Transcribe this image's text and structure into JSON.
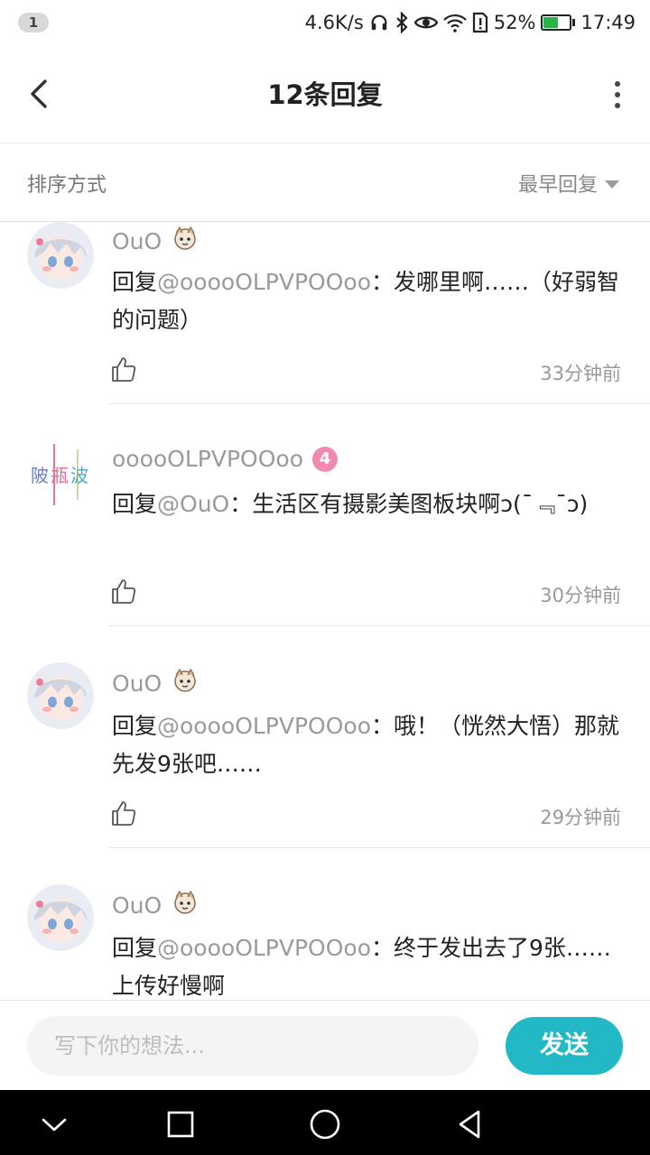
{
  "status_bar": {
    "notification_count": "1",
    "network_speed": "4.6K/s",
    "battery_percent": "52%",
    "battery_level": 0.52,
    "time": "17:49"
  },
  "header": {
    "title": "12条回复",
    "back_icon": "back-arrow-icon",
    "more_icon": "more-vertical-icon"
  },
  "sort": {
    "label": "排序方式",
    "selected": "最早回复"
  },
  "replies": [
    {
      "username": "OuO",
      "prefix": "回复",
      "mention": "@ooooOLPVPOOoo",
      "text": "：发哪里啊……（好弱智的问题）",
      "time": "33分钟前"
    },
    {
      "username": "ooooOLPVPOOoo",
      "level": "4",
      "prefix": "回复",
      "mention": "@OuO",
      "text": "：生活区有摄影美图板块啊ↄ(¯﹃¯ↄ)",
      "time": "30分钟前"
    },
    {
      "username": "OuO",
      "prefix": "回复",
      "mention": "@ooooOLPVPOOoo",
      "text": "：哦！（恍然大悟）那就先发9张吧……",
      "time": "29分钟前"
    },
    {
      "username": "OuO",
      "prefix": "回复",
      "mention": "@ooooOLPVPOOoo",
      "text": "：终于发出去了9张……上传好慢啊",
      "time": ""
    }
  ],
  "input": {
    "placeholder": "写下你的想法...",
    "value": ""
  },
  "send_label": "发送",
  "colors": {
    "accent": "#22b8c6",
    "level_badge": "#f28ab0",
    "muted_text": "#9a9a9a"
  }
}
